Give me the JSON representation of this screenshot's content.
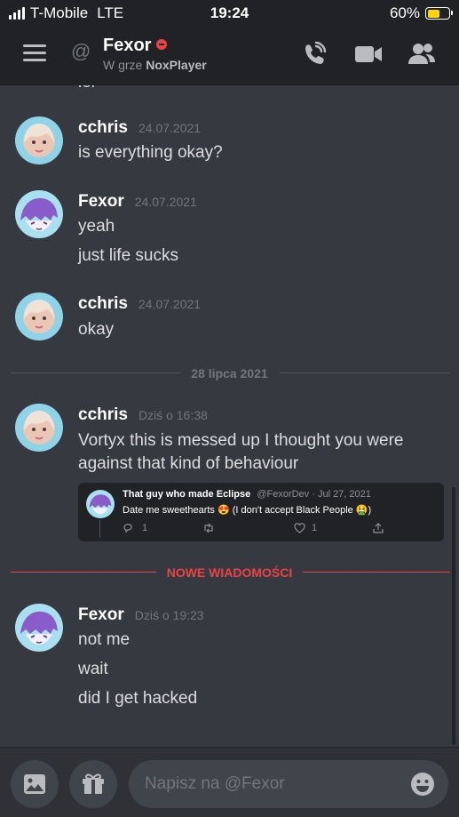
{
  "status_bar": {
    "carrier": "T-Mobile",
    "network": "LTE",
    "time": "19:24",
    "battery": "60%",
    "battery_level": 0.6
  },
  "header": {
    "at": "@",
    "name": "Fexor",
    "activity_prefix": "W grze",
    "activity_game": "NoxPlayer"
  },
  "chat": {
    "partial_text": "lol",
    "messages": [
      {
        "author": "cchris",
        "time": "24.07.2021",
        "lines": [
          "is everything okay?"
        ]
      },
      {
        "author": "Fexor",
        "time": "24.07.2021",
        "lines": [
          "yeah",
          "just life sucks"
        ]
      },
      {
        "author": "cchris",
        "time": "24.07.2021",
        "lines": [
          "okay"
        ]
      },
      {
        "author": "cchris",
        "time": "Dziś o 16:38",
        "lines": [
          "Vortyx this is messed up I thought you were",
          "against that kind of behaviour"
        ]
      },
      {
        "author": "Fexor",
        "time": "Dziś o 19:23",
        "lines": [
          "not me",
          "wait",
          "did I get hacked"
        ]
      }
    ],
    "date_divider": "28 lipca 2021",
    "new_messages_divider": "NOWE WIADOMOŚCI",
    "embed": {
      "display_name": "That guy who made Eclipse",
      "handle": "@FexorDev · Jul 27, 2021",
      "text": "Date me sweethearts 😍 (I don't accept Black People 🤮)",
      "replies": "1",
      "likes": "1"
    }
  },
  "composer": {
    "placeholder": "Napisz na @Fexor"
  },
  "colors": {
    "background": "#36393f",
    "header": "#202225",
    "new_messages": "#ed4245",
    "battery": "#ffd60a"
  }
}
